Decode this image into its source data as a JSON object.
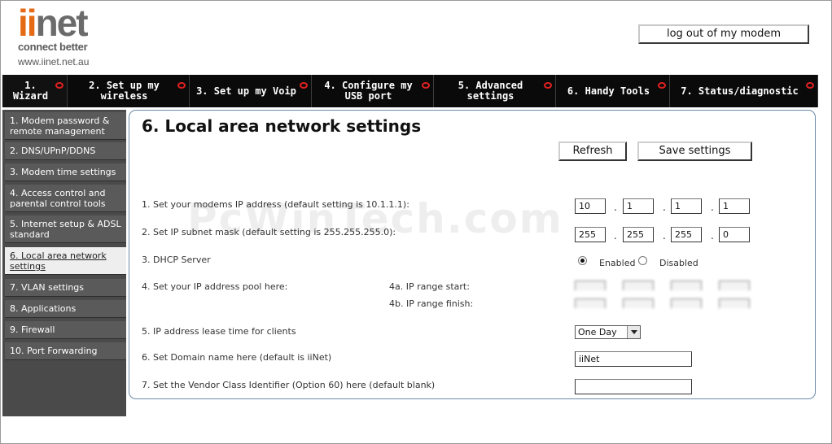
{
  "brand": {
    "logo_text": "iinet",
    "tagline": "connect better",
    "url": "www.iinet.net.au"
  },
  "header": {
    "logout_label": "log out of my modem"
  },
  "tabs": [
    {
      "label": "1. Wizard"
    },
    {
      "label": "2. Set up my wireless"
    },
    {
      "label": "3. Set up my Voip"
    },
    {
      "label": "4. Configure my USB port"
    },
    {
      "label": "5. Advanced settings"
    },
    {
      "label": "6. Handy Tools"
    },
    {
      "label": "7. Status/diagnostic"
    }
  ],
  "sidebar": {
    "items": [
      {
        "label": "1. Modem password & remote management"
      },
      {
        "label": "2. DNS/UPnP/DDNS"
      },
      {
        "label": "3. Modem time settings"
      },
      {
        "label": "4. Access control and parental control tools"
      },
      {
        "label": "5. Internet setup & ADSL standard"
      },
      {
        "label": "6. Local area network settings"
      },
      {
        "label": "7. VLAN settings"
      },
      {
        "label": "8. Applications"
      },
      {
        "label": "9. Firewall"
      },
      {
        "label": "10. Port Forwarding"
      }
    ]
  },
  "main": {
    "title": "6. Local area network settings",
    "refresh_label": "Refresh",
    "save_label": "Save settings",
    "row1": {
      "label": "1. Set your modems IP address (default setting is 10.1.1.1):",
      "octets": [
        "10",
        "1",
        "1",
        "1"
      ]
    },
    "row2": {
      "label": "2. Set IP subnet mask (default setting is 255.255.255.0):",
      "octets": [
        "255",
        "255",
        "255",
        "0"
      ]
    },
    "row3": {
      "label": "3. DHCP Server",
      "enabled_label": "Enabled",
      "disabled_label": "Disabled",
      "selected": "Enabled"
    },
    "row4": {
      "label": "4. Set your IP address pool here:",
      "start_label": "4a. IP range start:",
      "finish_label": "4b. IP range finish:"
    },
    "row5": {
      "label": "5. IP address lease time for clients",
      "value": "One Day"
    },
    "row6": {
      "label": "6. Set Domain name here (default is iiNet)",
      "value": "iiNet"
    },
    "row7": {
      "label": "7. Set the Vendor Class Identifier (Option 60) here (default blank)",
      "value": ""
    },
    "ip_separator": "."
  },
  "watermark": "PcWinTech.com",
  "colors": {
    "brand_orange": "#e46a15",
    "tab_bg": "#0a0a0a",
    "tab_indicator": "#e02020",
    "sidebar_bg": "#5a5a5a",
    "sidebar_active_bg": "#eeeeee",
    "panel_border": "#6a8aa8"
  }
}
